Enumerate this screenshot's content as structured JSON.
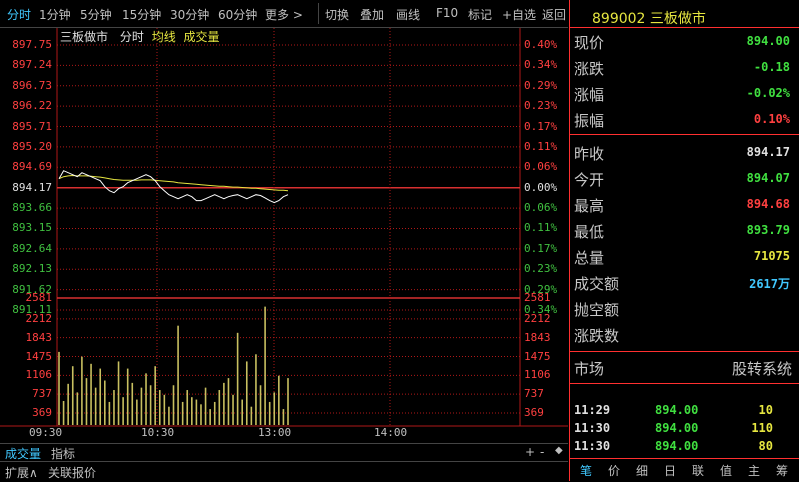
{
  "toolbar": {
    "items": [
      "分时",
      "1分钟",
      "5分钟",
      "15分钟",
      "30分钟",
      "60分钟",
      "更多",
      "切换",
      "叠加",
      "画线",
      "F10",
      "标记",
      "+自选",
      "返回"
    ],
    "more_arrow": ">"
  },
  "chart": {
    "legend": {
      "name": "三板做市",
      "mode": "分时",
      "avg": "均线",
      "vol": "成交量"
    },
    "price_labels": [
      "897.75",
      "897.24",
      "896.73",
      "896.22",
      "895.71",
      "895.20",
      "894.69",
      "894.17",
      "893.66",
      "893.15",
      "892.64",
      "892.13",
      "891.62",
      "891.11"
    ],
    "pct_labels": [
      "0.40%",
      "0.34%",
      "0.29%",
      "0.23%",
      "0.17%",
      "0.11%",
      "0.06%",
      "0.00%",
      "0.06%",
      "0.11%",
      "0.17%",
      "0.23%",
      "0.29%",
      "0.34%"
    ],
    "volume_labels": [
      "2581",
      "2212",
      "1843",
      "1475",
      "1106",
      "737",
      "369"
    ],
    "time_labels": [
      "09:30",
      "10:30",
      "13:00",
      "14:00"
    ],
    "colors": {
      "up": "#ff4040",
      "down": "#40c040",
      "flat": "#e0e0e0",
      "grid": "#b01818",
      "price_line": "#ffffff",
      "avg_line": "#e6e640",
      "volume": "#c8c060"
    }
  },
  "chart_data": {
    "type": "line",
    "title": "",
    "xlabel": "",
    "ylabel": "",
    "ylim": [
      891.11,
      897.75
    ],
    "prev_close": 894.17,
    "x_ticks": [
      "09:30",
      "10:30",
      "13:00",
      "14:00"
    ],
    "series": [
      {
        "values": [
          894.4,
          894.6,
          894.55,
          894.5,
          894.45,
          894.55,
          894.5,
          894.45,
          894.4,
          894.35,
          894.2,
          894.1,
          894.05,
          894.15,
          894.2,
          894.3,
          894.35,
          894.4,
          894.45,
          894.5,
          894.45,
          894.35,
          894.2,
          894.1,
          894.0,
          893.95,
          893.9,
          893.95,
          894.0,
          893.95,
          893.85,
          893.85,
          893.9,
          893.95,
          894.0,
          893.95,
          893.9,
          893.95,
          893.98,
          894.0,
          893.95,
          893.9,
          893.95,
          894.0,
          893.98,
          893.92,
          893.85,
          893.8,
          893.85,
          893.95,
          894.0
        ]
      },
      {
        "values": [
          894.4,
          894.45,
          894.47,
          894.48,
          894.47,
          894.47,
          894.47,
          894.46,
          894.45,
          894.44,
          894.42,
          894.4,
          894.38,
          894.37,
          894.36,
          894.36,
          894.36,
          894.36,
          894.37,
          894.37,
          894.37,
          894.36,
          894.35,
          894.34,
          894.33,
          894.32,
          894.3,
          894.29,
          894.28,
          894.27,
          894.26,
          894.25,
          894.24,
          894.23,
          894.22,
          894.21,
          894.21,
          894.2,
          894.19,
          894.19,
          894.18,
          894.17,
          894.16,
          894.16,
          894.15,
          894.14,
          894.13,
          894.12,
          894.11,
          894.11,
          894.1
        ]
      }
    ],
    "volume": [
      1450,
      420,
      780,
      1150,
      600,
      1350,
      900,
      1200,
      700,
      1100,
      850,
      400,
      650,
      1250,
      500,
      1100,
      800,
      450,
      700,
      1000,
      750,
      1150,
      650,
      550,
      300,
      750,
      2000,
      400,
      650,
      500,
      450,
      350,
      700,
      250,
      400,
      650,
      800,
      900,
      550,
      1850,
      450,
      1250,
      300,
      1400,
      750,
      2400,
      400,
      600,
      950,
      250,
      900
    ],
    "volume_ylim": [
      0,
      2581
    ]
  },
  "bottom": {
    "tab1": "成交量",
    "tab2": "指标",
    "plus": "+",
    "minus": "-",
    "menu": "◆",
    "tab3": "扩展∧",
    "tab4": "关联报价"
  },
  "panel": {
    "code": "899002",
    "name": "三板做市",
    "quote": [
      {
        "k": "现价",
        "v": "894.00",
        "c": "dn"
      },
      {
        "k": "涨跌",
        "v": "-0.18",
        "c": "dn"
      },
      {
        "k": "涨幅",
        "v": "-0.02%",
        "c": "dn"
      },
      {
        "k": "振幅",
        "v": "0.10%",
        "c": "up"
      }
    ],
    "stats": [
      {
        "k": "昨收",
        "v": "894.17",
        "c": "flat"
      },
      {
        "k": "今开",
        "v": "894.07",
        "c": "dn"
      },
      {
        "k": "最高",
        "v": "894.68",
        "c": "up"
      },
      {
        "k": "最低",
        "v": "893.79",
        "c": "dn"
      },
      {
        "k": "总量",
        "v": "71075",
        "c": "yel"
      },
      {
        "k": "成交额",
        "v": "2617万",
        "c": "cyan"
      },
      {
        "k": "抛空额",
        "v": "",
        "c": "flat"
      },
      {
        "k": "涨跌数",
        "v": "",
        "c": "flat"
      }
    ],
    "market_label": "市场",
    "market_value": "股转系统",
    "ticks": [
      {
        "t": "11:29",
        "p": "894.00",
        "v": "10"
      },
      {
        "t": "11:30",
        "p": "894.00",
        "v": "110"
      },
      {
        "t": "11:30",
        "p": "894.00",
        "v": "80"
      }
    ],
    "tabs": [
      "笔",
      "价",
      "细",
      "日",
      "联",
      "值",
      "主",
      "筹"
    ]
  }
}
